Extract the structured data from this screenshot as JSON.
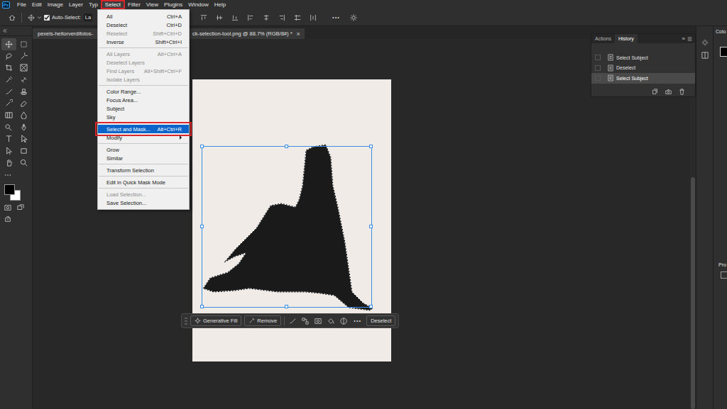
{
  "app": {
    "logo": "Ps"
  },
  "menu_bar": [
    {
      "label": "File",
      "selected": false,
      "annotated": false
    },
    {
      "label": "Edit",
      "selected": false,
      "annotated": false
    },
    {
      "label": "Image",
      "selected": false,
      "annotated": false
    },
    {
      "label": "Layer",
      "selected": false,
      "annotated": false
    },
    {
      "label": "Typ",
      "selected": false,
      "annotated": false
    },
    {
      "label": "Select",
      "selected": true,
      "annotated": true
    },
    {
      "label": "Filter",
      "selected": false,
      "annotated": false
    },
    {
      "label": "View",
      "selected": false,
      "annotated": false
    },
    {
      "label": "Plugins",
      "selected": false,
      "annotated": false
    },
    {
      "label": "Window",
      "selected": false,
      "annotated": false
    },
    {
      "label": "Help",
      "selected": false,
      "annotated": false
    }
  ],
  "options_bar": {
    "auto_select_label": "Auto-Select:",
    "auto_select_checked": true,
    "target_dropdown": "La",
    "more": "•••"
  },
  "document_tab": {
    "label_start": "pexels-heitorverdifotos-",
    "label_end": "ck-selection-tool.png @ 88.7% (RGB/8#) *",
    "close": "×",
    "selected": true
  },
  "select_menu": [
    {
      "kind": "item",
      "label": "All",
      "shortcut": "Ctrl+A",
      "disabled": false,
      "selected": false,
      "annotated": false,
      "submenu": false
    },
    {
      "kind": "item",
      "label": "Deselect",
      "shortcut": "Ctrl+D",
      "disabled": false,
      "selected": false,
      "annotated": false,
      "submenu": false
    },
    {
      "kind": "item",
      "label": "Reselect",
      "shortcut": "Shift+Ctrl+D",
      "disabled": true,
      "selected": false,
      "annotated": false,
      "submenu": false
    },
    {
      "kind": "item",
      "label": "Inverse",
      "shortcut": "Shift+Ctrl+I",
      "disabled": false,
      "selected": false,
      "annotated": false,
      "submenu": false
    },
    {
      "kind": "separator"
    },
    {
      "kind": "item",
      "label": "All Layers",
      "shortcut": "Alt+Ctrl+A",
      "disabled": true,
      "selected": false,
      "annotated": false,
      "submenu": false
    },
    {
      "kind": "item",
      "label": "Deselect Layers",
      "shortcut": "",
      "disabled": true,
      "selected": false,
      "annotated": false,
      "submenu": false
    },
    {
      "kind": "item",
      "label": "Find Layers",
      "shortcut": "Alt+Shift+Ctrl+F",
      "disabled": true,
      "selected": false,
      "annotated": false,
      "submenu": false
    },
    {
      "kind": "item",
      "label": "Isolate Layers",
      "shortcut": "",
      "disabled": true,
      "selected": false,
      "annotated": false,
      "submenu": false
    },
    {
      "kind": "separator"
    },
    {
      "kind": "item",
      "label": "Color Range...",
      "shortcut": "",
      "disabled": false,
      "selected": false,
      "annotated": false,
      "submenu": false
    },
    {
      "kind": "item",
      "label": "Focus Area...",
      "shortcut": "",
      "disabled": false,
      "selected": false,
      "annotated": false,
      "submenu": false
    },
    {
      "kind": "item",
      "label": "Subject",
      "shortcut": "",
      "disabled": false,
      "selected": false,
      "annotated": false,
      "submenu": false
    },
    {
      "kind": "item",
      "label": "Sky",
      "shortcut": "",
      "disabled": false,
      "selected": false,
      "annotated": false,
      "submenu": false
    },
    {
      "kind": "separator"
    },
    {
      "kind": "item",
      "label": "Select and Mask...",
      "shortcut": "Alt+Ctrl+R",
      "disabled": false,
      "selected": true,
      "annotated": true,
      "submenu": false
    },
    {
      "kind": "item",
      "label": "Modify",
      "shortcut": "",
      "disabled": false,
      "selected": false,
      "annotated": false,
      "submenu": true
    },
    {
      "kind": "separator"
    },
    {
      "kind": "item",
      "label": "Grow",
      "shortcut": "",
      "disabled": false,
      "selected": false,
      "annotated": false,
      "submenu": false
    },
    {
      "kind": "item",
      "label": "Similar",
      "shortcut": "",
      "disabled": false,
      "selected": false,
      "annotated": false,
      "submenu": false
    },
    {
      "kind": "separator"
    },
    {
      "kind": "item",
      "label": "Transform Selection",
      "shortcut": "",
      "disabled": false,
      "selected": false,
      "annotated": false,
      "submenu": false
    },
    {
      "kind": "separator"
    },
    {
      "kind": "item",
      "label": "Edit in Quick Mask Mode",
      "shortcut": "",
      "disabled": false,
      "selected": false,
      "annotated": false,
      "submenu": false
    },
    {
      "kind": "separator"
    },
    {
      "kind": "item",
      "label": "Load Selection...",
      "shortcut": "",
      "disabled": true,
      "selected": false,
      "annotated": false,
      "submenu": false
    },
    {
      "kind": "item",
      "label": "Save Selection...",
      "shortcut": "",
      "disabled": false,
      "selected": false,
      "annotated": false,
      "submenu": false
    }
  ],
  "history_panel": {
    "tabs": [
      {
        "label": "Actions",
        "selected": false
      },
      {
        "label": "History",
        "selected": true
      }
    ],
    "expand": "»",
    "items": [
      {
        "label": "Select Subject",
        "selected": false
      },
      {
        "label": "Deselect",
        "selected": false
      },
      {
        "label": "Select Subject",
        "selected": true
      }
    ]
  },
  "task_bar": {
    "buttons": [
      {
        "label": "Generative Fill"
      },
      {
        "label": "Remove"
      }
    ],
    "more": "•••",
    "deselect": "Deselect"
  },
  "side_panels": [
    {
      "label": "Colo"
    },
    {
      "label": "Pro"
    }
  ]
}
